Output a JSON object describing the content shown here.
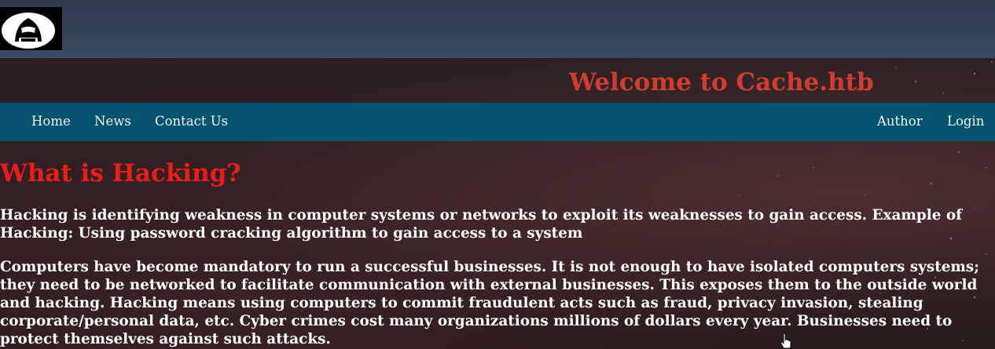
{
  "header": {
    "logo_icon": "hacker-hooded-figure-icon",
    "site_title": "Welcome to Cache.htb"
  },
  "nav": {
    "left_items": [
      {
        "label": "Home"
      },
      {
        "label": "News"
      },
      {
        "label": "Contact Us"
      }
    ],
    "right_items": [
      {
        "label": "Author"
      },
      {
        "label": "Login"
      }
    ]
  },
  "main": {
    "heading": "What is Hacking?",
    "paragraphs": [
      "Hacking is identifying weakness in computer systems or networks to exploit its weaknesses to gain access. Example of Hacking: Using password cracking algorithm to gain access to a system",
      "Computers have become mandatory to run a successful businesses. It is not enough to have isolated computers systems; they need to be networked to facilitate communication with external businesses. This exposes them to the outside world and hacking. Hacking means using computers to commit fraudulent acts such as fraud, privacy invasion, stealing corporate/personal data, etc. Cyber crimes cost many organizations millions of dollars every year. Businesses need to protect themselves against such attacks."
    ]
  },
  "colors": {
    "banner": "#354458",
    "navbar": "#06536f",
    "site_title": "#d23b35",
    "heading": "#ec1c1c",
    "body_text": "#ffffff",
    "background": "#2a1d1f"
  }
}
